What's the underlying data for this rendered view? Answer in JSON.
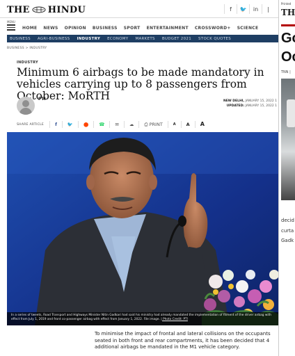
{
  "header": {
    "logo_text": "THE HINDU",
    "logo_left": "THE",
    "logo_right": "HINDU",
    "social": [
      "f",
      "🐦",
      "in",
      "|"
    ]
  },
  "nav": {
    "menu_label": "MENU",
    "items": [
      "HOME",
      "NEWS",
      "OPINION",
      "BUSINESS",
      "SPORT",
      "ENTERTAINMENT",
      "CROSSWORD+",
      "SCIENCE"
    ]
  },
  "subnav": {
    "items": [
      "BUSINESS",
      "AGRI-BUSINESS",
      "INDUSTRY",
      "ECONOMY",
      "MARKETS",
      "BUDGET 2021",
      "STOCK QUOTES"
    ],
    "active": "INDUSTRY"
  },
  "breadcrumb": "BUSINESS  >  INDUSTRY",
  "article": {
    "section": "INDUSTRY",
    "headline": "Minimum 6 airbags to be made mandatory in vehicles carrying up to 8 passengers from October: MoRTH",
    "author": "PTI",
    "dateline": "NEW DELHI,",
    "date_published": "JANUARY 15, 2022 1",
    "updated_label": "UPDATED:",
    "date_updated": "JANUARY 15, 2022 1",
    "share_label": "SHARE ARTICLE",
    "share_icons": [
      "f",
      "🐦",
      "⬤",
      "☎",
      "✉",
      "☁",
      "⎙ PRINT",
      "A",
      "A",
      "A"
    ],
    "caption": "In a series of tweets, Road Transport and Highways Minister Nitin Gadkari had said his ministry had already mandated the implementation of fitment of the driver airbag with effect from July 1, 2019 and front co-passenger airbag with effect from January 1, 2022. File image.",
    "photo_credit": "| Photo Credit: PTI",
    "lead": "To minimise the impact of frontal and lateral collisions on the occupants seated in both front and rear compartments, it has been decided that 4 additional airbags be mandated in the M1 vehicle category."
  },
  "side_panel": {
    "printed": "Printed",
    "logo": "TH",
    "title_lines": [
      "Go",
      "Oc"
    ],
    "source": "TNN |",
    "text_lines": [
      "decid",
      "curta",
      "Gadk"
    ]
  }
}
